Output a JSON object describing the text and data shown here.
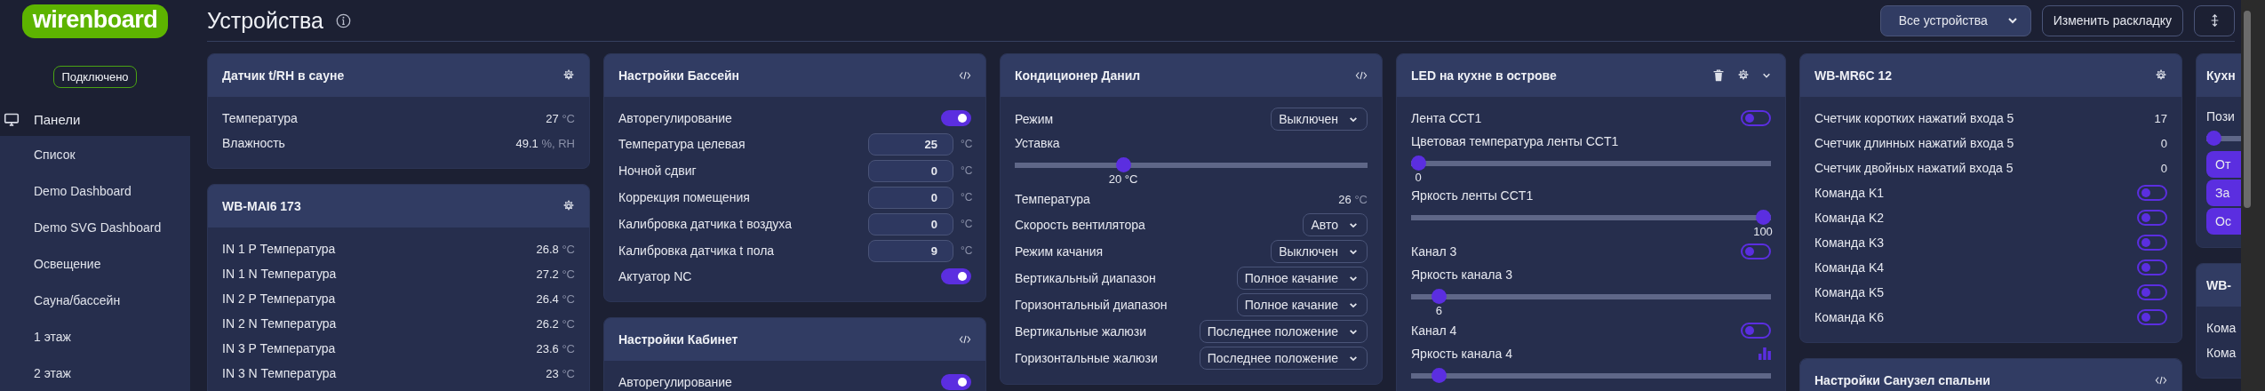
{
  "sidebar": {
    "logo": "wirenboard",
    "status": "Подключено",
    "nav": [
      {
        "label": "Панели",
        "expanded": true,
        "children": [
          {
            "label": "Список"
          },
          {
            "label": "Demo Dashboard"
          },
          {
            "label": "Demo SVG Dashboard"
          },
          {
            "label": "Освещение"
          },
          {
            "label": "Сауна/бассейн"
          },
          {
            "label": "1 этаж"
          },
          {
            "label": "2 этаж"
          }
        ]
      }
    ]
  },
  "header": {
    "title": "Устройства",
    "filter": "Все устройства",
    "edit_button": "Изменить раскладку"
  },
  "columns": [
    {
      "cards": [
        {
          "title": "Датчик t/RH в сауне",
          "settings_icon": true,
          "rows": [
            {
              "kind": "value",
              "label": "Температура",
              "value": "27",
              "unit": "°C"
            },
            {
              "kind": "value",
              "label": "Влажность",
              "value": "49.1",
              "unit": "%, RH"
            }
          ]
        },
        {
          "title": "WB-MAI6 173",
          "settings_icon": true,
          "rows": [
            {
              "kind": "value",
              "label": "IN 1 P Температура",
              "value": "26.8",
              "unit": "°C"
            },
            {
              "kind": "value",
              "label": "IN 1 N Температура",
              "value": "27.2",
              "unit": "°C"
            },
            {
              "kind": "value",
              "label": "IN 2 P Температура",
              "value": "26.4",
              "unit": "°C"
            },
            {
              "kind": "value",
              "label": "IN 2 N Температура",
              "value": "26.2",
              "unit": "°C"
            },
            {
              "kind": "value",
              "label": "IN 3 P Температура",
              "value": "23.6",
              "unit": "°C"
            },
            {
              "kind": "value",
              "label": "IN 3 N Температура",
              "value": "23",
              "unit": "°C"
            }
          ]
        }
      ]
    },
    {
      "cards": [
        {
          "title": "Настройки Бассейн",
          "code_icon": true,
          "rows": [
            {
              "kind": "toggle",
              "label": "Авторегулирование",
              "on": true
            },
            {
              "kind": "input",
              "label": "Температура целевая",
              "value": "25",
              "unit": "°C"
            },
            {
              "kind": "input",
              "label": "Ночной сдвиг",
              "value": "0",
              "unit": "°C"
            },
            {
              "kind": "input",
              "label": "Коррекция помещения",
              "value": "0",
              "unit": "°C"
            },
            {
              "kind": "input",
              "label": "Калибровка датчика t воздуха",
              "value": "0",
              "unit": "°C"
            },
            {
              "kind": "input",
              "label": "Калибровка датчика t пола",
              "value": "9",
              "unit": "°C"
            },
            {
              "kind": "toggle",
              "label": "Актуатор NC",
              "on": true
            }
          ]
        },
        {
          "title": "Настройки Кабинет",
          "code_icon": true,
          "rows": [
            {
              "kind": "toggle",
              "label": "Авторегулирование",
              "on": true
            }
          ]
        }
      ]
    },
    {
      "cards": [
        {
          "title": "Кондиционер Данил",
          "code_icon": true,
          "rows": [
            {
              "kind": "select",
              "label": "Режим",
              "value": "Выключен"
            },
            {
              "kind": "slider",
              "label": "Уставка",
              "level": 0.3,
              "reading": "20 °C"
            },
            {
              "kind": "value",
              "label": "Температура",
              "value": "26",
              "unit": "°C"
            },
            {
              "kind": "select",
              "label": "Скорость вентилятора",
              "value": "Авто"
            },
            {
              "kind": "select",
              "label": "Режим качания",
              "value": "Выключен"
            },
            {
              "kind": "select",
              "label": "Вертикальный диапазон",
              "value": "Полное качание"
            },
            {
              "kind": "select",
              "label": "Горизонтальный диапазон",
              "value": "Полное качание"
            },
            {
              "kind": "select",
              "label": "Вертикальные жалюзи",
              "value": "Последнее положение"
            },
            {
              "kind": "select",
              "label": "Горизонтальные жалюзи",
              "value": "Последнее положение"
            }
          ]
        }
      ]
    },
    {
      "cards": [
        {
          "title": "LED на кухне в острове",
          "delete_icon": true,
          "settings_icon": true,
          "collapse_icon": true,
          "rows": [
            {
              "kind": "toggle",
              "label": "Лента CCT1",
              "on": false
            },
            {
              "kind": "slider",
              "label": "Цветовая температура ленты CCT1",
              "level": 0,
              "reading": "0"
            },
            {
              "kind": "slider",
              "label": "Яркость ленты CCT1",
              "level": 1,
              "reading": "100"
            },
            {
              "kind": "toggle",
              "label": "Канал 3",
              "on": false
            },
            {
              "kind": "slider",
              "label": "Яркость канала 3",
              "level": 0.06,
              "reading": "6"
            },
            {
              "kind": "toggle",
              "label": "Канал 4",
              "on": false
            },
            {
              "kind": "slider",
              "label": "Яркость канала 4",
              "level": 0.06,
              "chart_icon": true
            }
          ]
        }
      ]
    },
    {
      "cards": [
        {
          "title": "WB-MR6C 12",
          "settings_icon": true,
          "rows": [
            {
              "kind": "value",
              "label": "Счетчик коротких нажатий входа 5",
              "value": "17"
            },
            {
              "kind": "value",
              "label": "Счетчик длинных нажатий входа 5",
              "value": "0"
            },
            {
              "kind": "value",
              "label": "Счетчик двойных нажатий входа 5",
              "value": "0"
            },
            {
              "kind": "toggle",
              "label": "Команда K1",
              "on": false
            },
            {
              "kind": "toggle",
              "label": "Команда K2",
              "on": false
            },
            {
              "kind": "toggle",
              "label": "Команда K3",
              "on": false
            },
            {
              "kind": "toggle",
              "label": "Команда K4",
              "on": false
            },
            {
              "kind": "toggle",
              "label": "Команда K5",
              "on": false
            },
            {
              "kind": "toggle",
              "label": "Команда K6",
              "on": false
            }
          ]
        },
        {
          "title": "Настройки Санузел спальни",
          "code_icon": true
        }
      ]
    },
    {
      "cards": [
        {
          "title": "Кухн",
          "rows": [
            {
              "kind": "slider",
              "label": "Пози",
              "level": 0
            },
            {
              "kind": "button",
              "label": "От"
            },
            {
              "kind": "button",
              "label": "За"
            },
            {
              "kind": "button",
              "label": "Ос"
            }
          ]
        },
        {
          "title": "WB-",
          "rows": [
            {
              "kind": "value",
              "label": "Кома"
            },
            {
              "kind": "value",
              "label": "Кома"
            }
          ]
        }
      ]
    }
  ]
}
